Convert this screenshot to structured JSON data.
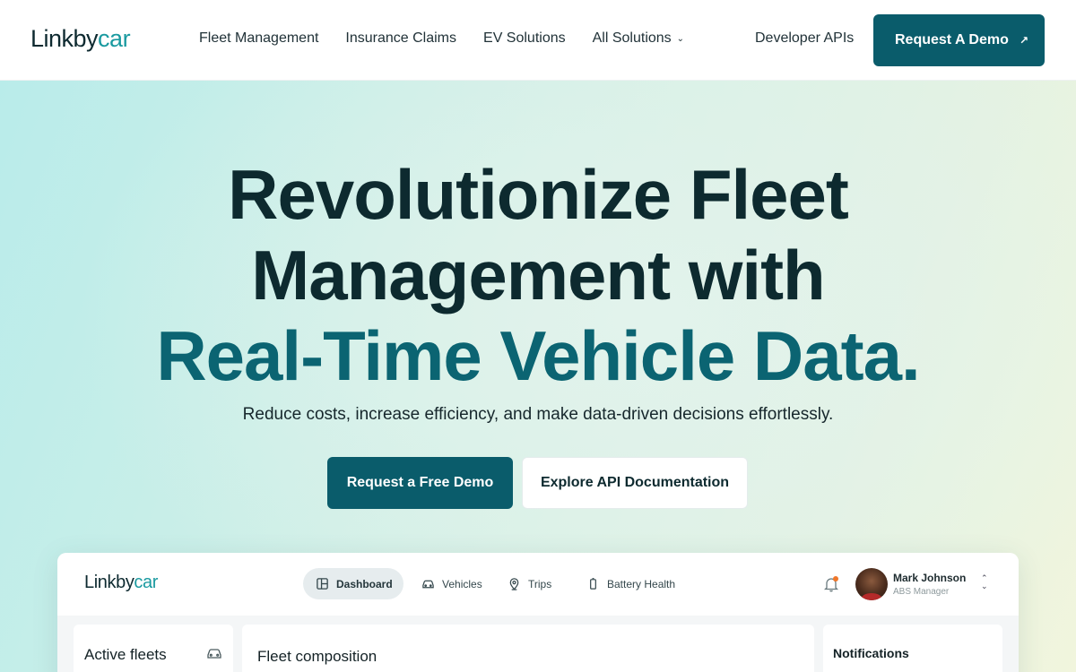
{
  "nav": {
    "logo_main": "Linkby",
    "logo_accent": "car",
    "links": [
      {
        "label": "Fleet Management"
      },
      {
        "label": "Insurance Claims"
      },
      {
        "label": "EV Solutions"
      },
      {
        "label": "All Solutions"
      }
    ],
    "developer": "Developer APIs",
    "demo_button": "Request A Demo",
    "demo_arrow": "↗"
  },
  "hero": {
    "line1": "Revolutionize Fleet",
    "line2": "Management with",
    "line3": "Real-Time Vehicle Data.",
    "subtitle": "Reduce costs, increase efficiency, and make data-driven decisions effortlessly.",
    "cta_primary": "Request a Free Demo",
    "cta_secondary": "Explore API Documentation"
  },
  "app": {
    "logo_main": "Linkby",
    "logo_accent": "car",
    "tabs": [
      {
        "label": "Dashboard",
        "icon": "dashboard-icon"
      },
      {
        "label": "Vehicles",
        "icon": "car-icon"
      },
      {
        "label": "Trips",
        "icon": "location-pin-icon"
      },
      {
        "label": "Battery Health",
        "icon": "battery-icon"
      }
    ],
    "user": {
      "name": "Mark Johnson",
      "role": "ABS Manager"
    },
    "cards": {
      "active_fleets": "Active fleets",
      "fleet_composition": "Fleet composition",
      "notifications": "Notifications"
    }
  },
  "colors": {
    "brand_dark": "#0a5c6b",
    "brand_accent": "#1a9aa0",
    "heading": "#0d2a2f",
    "alert_dot": "#f0772a"
  }
}
